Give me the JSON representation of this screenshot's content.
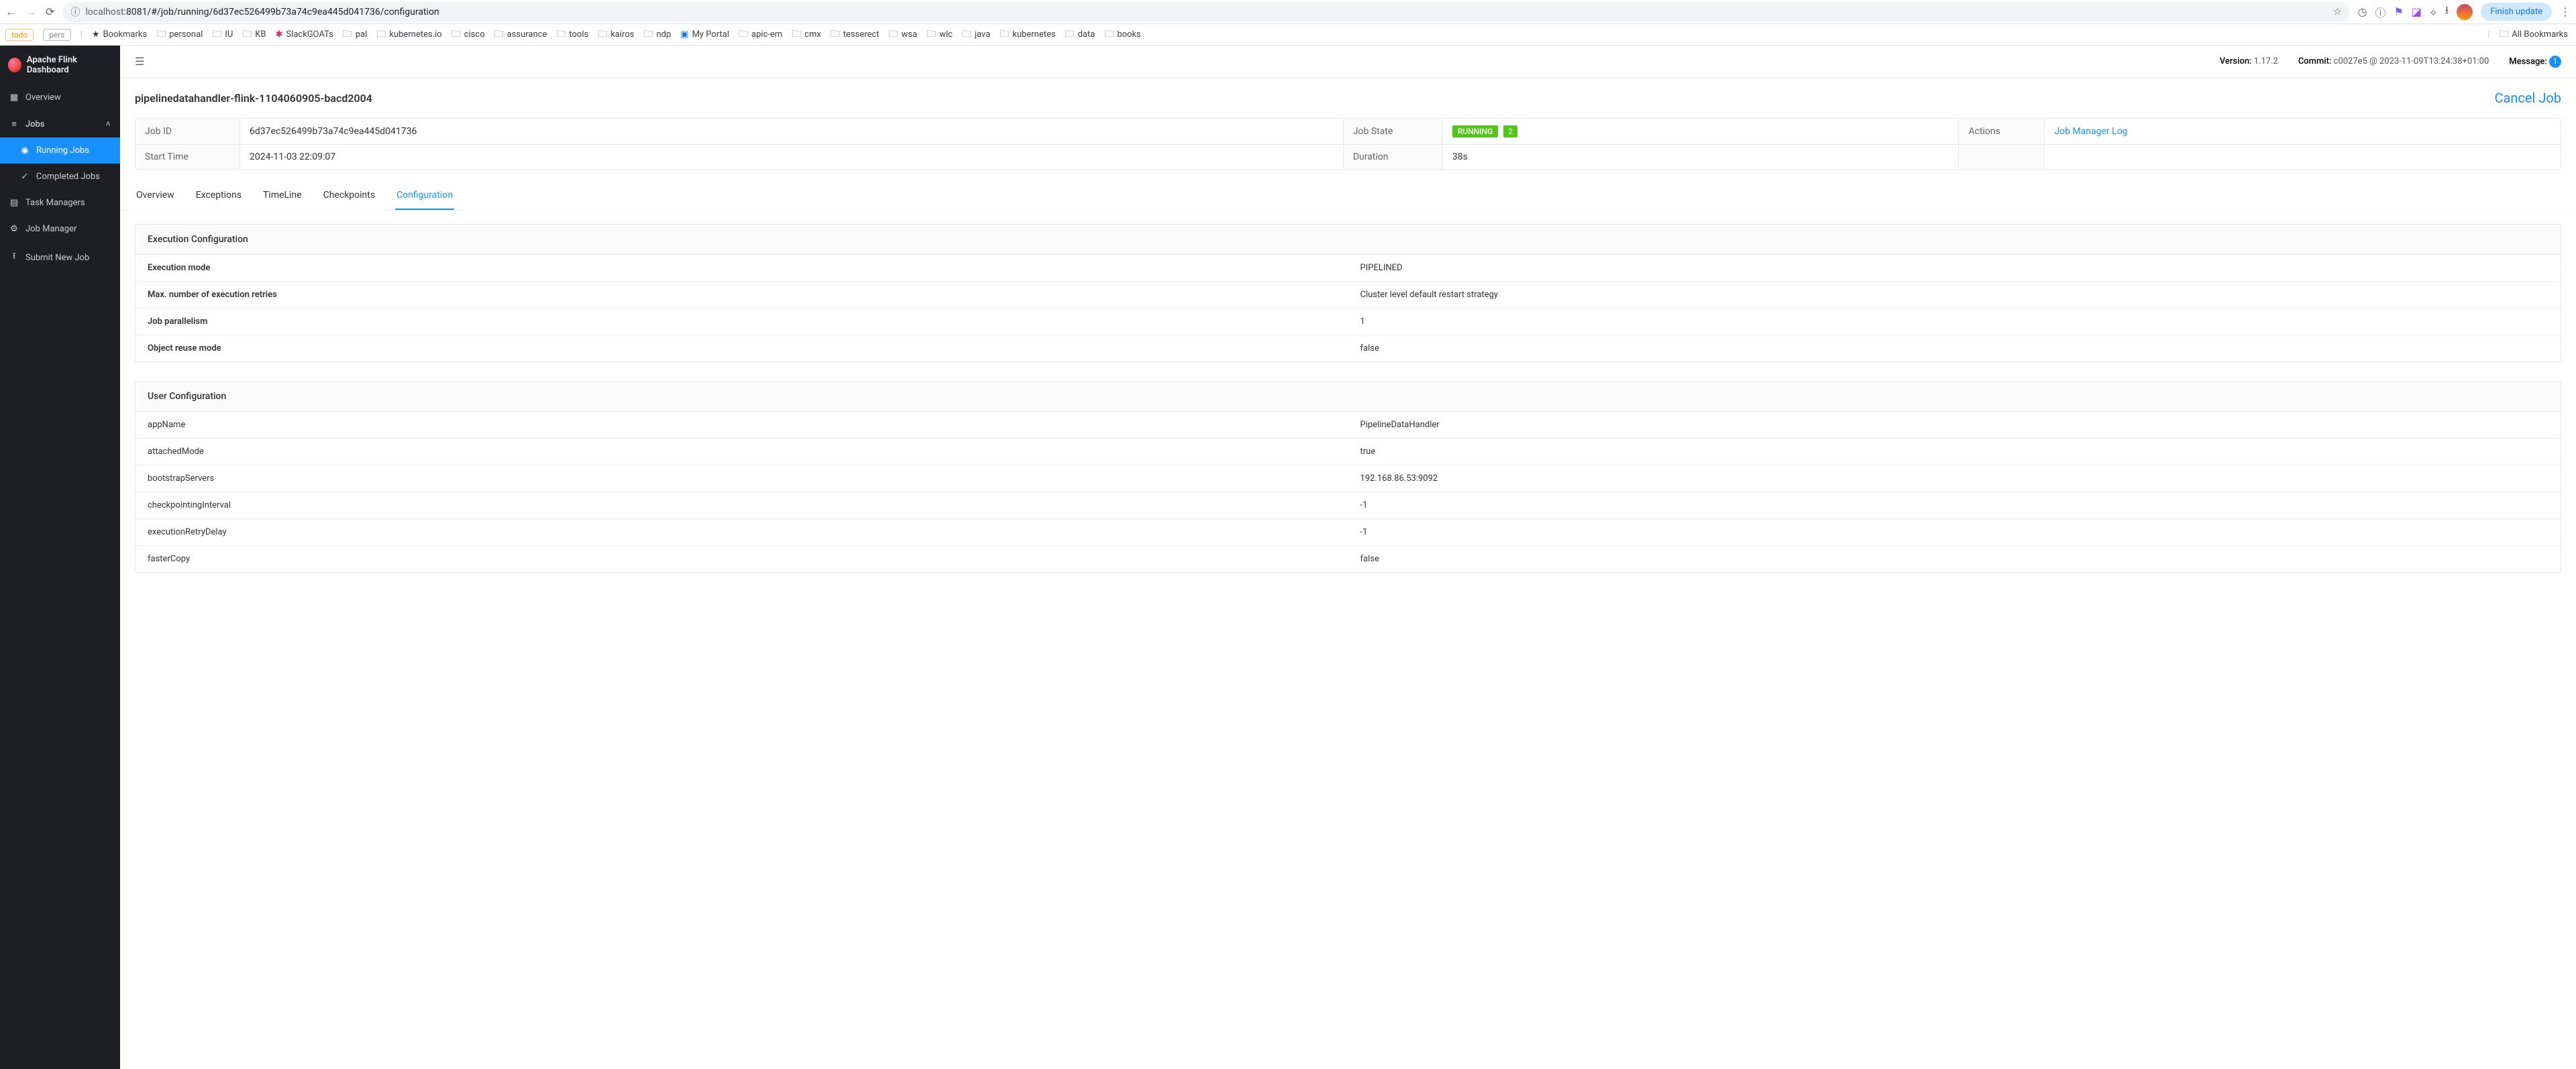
{
  "browser": {
    "url_host": "localhost",
    "url_path": ":8081/#/job/running/6d37ec526499b73a74c9ea445d041736/configuration",
    "finish_update": "Finish update"
  },
  "bookmarks": {
    "chip_todo": "todo",
    "chip_pers": "pers",
    "star": "Bookmarks",
    "items": [
      "personal",
      "IU",
      "KB",
      "SlackGOATs",
      "pal",
      "kubernetes.io",
      "cisco",
      "assurance",
      "tools",
      "kairos",
      "ndp",
      "My Portal",
      "apic-em",
      "cmx",
      "tesserect",
      "wsa",
      "wlc",
      "java",
      "kubernetes",
      "data",
      "books"
    ],
    "all": "All Bookmarks"
  },
  "sidebar": {
    "title": "Apache Flink Dashboard",
    "overview": "Overview",
    "jobs": "Jobs",
    "running": "Running Jobs",
    "completed": "Completed Jobs",
    "task_managers": "Task Managers",
    "job_manager": "Job Manager",
    "submit": "Submit New Job"
  },
  "topbar": {
    "version_label": "Version:",
    "version": "1.17.2",
    "commit_label": "Commit:",
    "commit": "c0027e5 @ 2023-11-09T13:24:38+01:00",
    "message_label": "Message:",
    "message_count": "1"
  },
  "page": {
    "title": "pipelinedatahandler-flink-1104060905-bacd2004",
    "cancel": "Cancel Job"
  },
  "info": {
    "job_id_label": "Job ID",
    "job_id": "6d37ec526499b73a74c9ea445d041736",
    "state_label": "Job State",
    "state_badge": "RUNNING",
    "state_count": "2",
    "actions_label": "Actions",
    "actions_link": "Job Manager Log",
    "start_label": "Start Time",
    "start": "2024-11-03 22:09:07",
    "duration_label": "Duration",
    "duration": "38s"
  },
  "tabs": [
    "Overview",
    "Exceptions",
    "TimeLine",
    "Checkpoints",
    "Configuration"
  ],
  "exec_cfg": {
    "title": "Execution Configuration",
    "rows": [
      {
        "k": "Execution mode",
        "v": "PIPELINED"
      },
      {
        "k": "Max. number of execution retries",
        "v": "Cluster level default restart strategy"
      },
      {
        "k": "Job parallelism",
        "v": "1"
      },
      {
        "k": "Object reuse mode",
        "v": "false"
      }
    ]
  },
  "user_cfg": {
    "title": "User Configuration",
    "rows": [
      {
        "k": "appName",
        "v": "PipelineDataHandler"
      },
      {
        "k": "attachedMode",
        "v": "true"
      },
      {
        "k": "bootstrapServers",
        "v": "192.168.86.53:9092"
      },
      {
        "k": "checkpointingInterval",
        "v": "-1"
      },
      {
        "k": "executionRetryDelay",
        "v": "-1"
      },
      {
        "k": "fasterCopy",
        "v": "false"
      }
    ]
  }
}
